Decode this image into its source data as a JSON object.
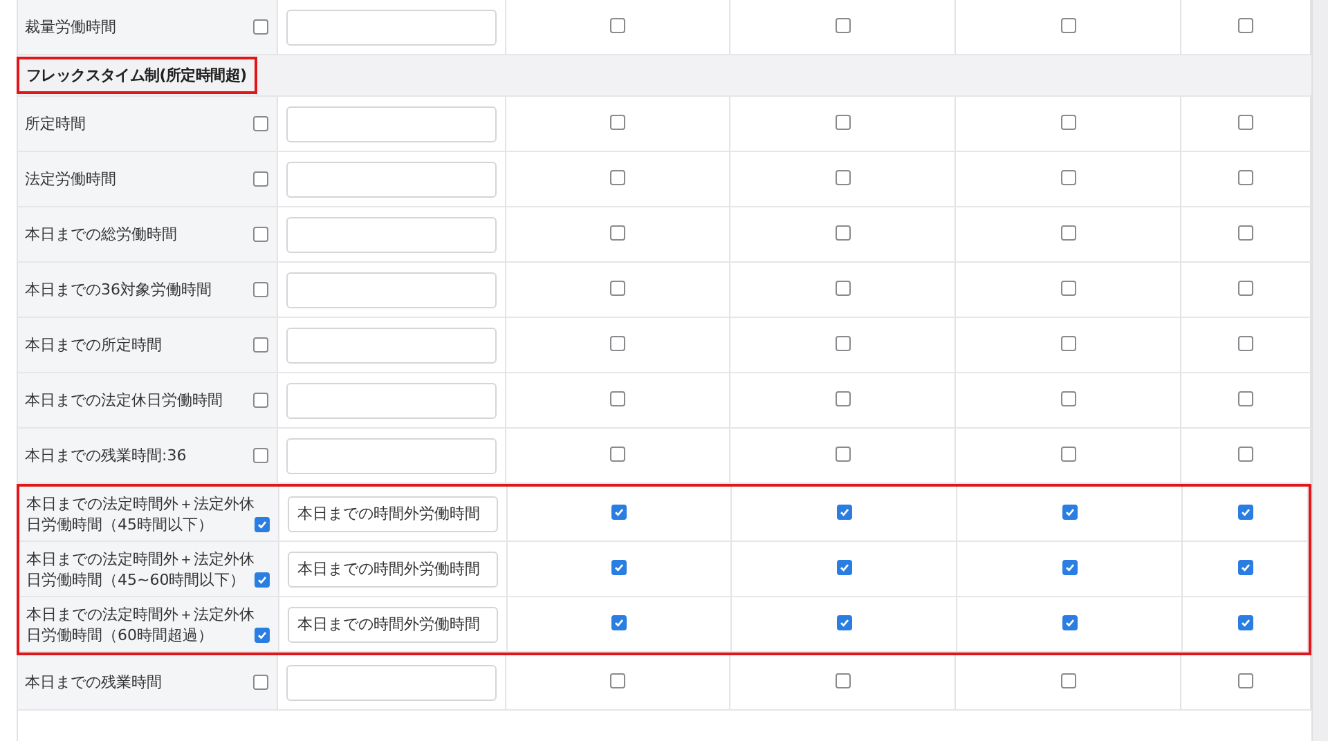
{
  "rows": [
    {
      "kind": "row",
      "label": "裁量労働時間",
      "checked": false,
      "columns": [
        {
          "checked": false
        },
        {
          "checked": false
        },
        {
          "checked": false
        },
        {
          "checked": false
        }
      ]
    },
    {
      "kind": "section",
      "title": "フレックスタイム制(所定時間超)",
      "highlighted": true
    },
    {
      "kind": "row",
      "label": "所定時間",
      "checked": false,
      "columns": [
        {
          "checked": false
        },
        {
          "checked": false
        },
        {
          "checked": false
        },
        {
          "checked": false
        }
      ]
    },
    {
      "kind": "row",
      "label": "法定労働時間",
      "checked": false,
      "columns": [
        {
          "checked": false
        },
        {
          "checked": false
        },
        {
          "checked": false
        },
        {
          "checked": false
        }
      ]
    },
    {
      "kind": "row",
      "label": "本日までの総労働時間",
      "checked": false,
      "columns": [
        {
          "checked": false
        },
        {
          "checked": false
        },
        {
          "checked": false
        },
        {
          "checked": false
        }
      ]
    },
    {
      "kind": "row",
      "label": "本日までの36対象労働時間",
      "checked": false,
      "columns": [
        {
          "checked": false
        },
        {
          "checked": false
        },
        {
          "checked": false
        },
        {
          "checked": false
        }
      ]
    },
    {
      "kind": "row",
      "label": "本日までの所定時間",
      "checked": false,
      "columns": [
        {
          "checked": false
        },
        {
          "checked": false
        },
        {
          "checked": false
        },
        {
          "checked": false
        }
      ]
    },
    {
      "kind": "row",
      "label": "本日までの法定休日労働時間",
      "checked": false,
      "columns": [
        {
          "checked": false
        },
        {
          "checked": false
        },
        {
          "checked": false
        },
        {
          "checked": false
        }
      ]
    },
    {
      "kind": "row",
      "label": "本日までの残業時間:36",
      "checked": false,
      "columns": [
        {
          "checked": false
        },
        {
          "checked": false
        },
        {
          "checked": false
        },
        {
          "checked": false
        }
      ]
    },
    {
      "kind": "group",
      "highlighted": true,
      "rows": [
        {
          "label": "本日までの法定時間外＋法定外休日労働時間（45時間以下）",
          "checked": true,
          "value": "本日までの時間外労働時間",
          "columns": [
            {
              "checked": true
            },
            {
              "checked": true
            },
            {
              "checked": true
            },
            {
              "checked": true
            }
          ]
        },
        {
          "label": "本日までの法定時間外＋法定外休日労働時間（45~60時間以下）",
          "checked": true,
          "value": "本日までの時間外労働時間",
          "columns": [
            {
              "checked": true
            },
            {
              "checked": true
            },
            {
              "checked": true
            },
            {
              "checked": true
            }
          ]
        },
        {
          "label": "本日までの法定時間外＋法定外休日労働時間（60時間超過）",
          "checked": true,
          "value": "本日までの時間外労働時間",
          "columns": [
            {
              "checked": true
            },
            {
              "checked": true
            },
            {
              "checked": true
            },
            {
              "checked": true
            }
          ]
        }
      ]
    },
    {
      "kind": "row",
      "label": "本日までの残業時間",
      "checked": false,
      "columns": [
        {
          "checked": false
        },
        {
          "checked": false
        },
        {
          "checked": false
        },
        {
          "checked": false
        }
      ]
    }
  ]
}
